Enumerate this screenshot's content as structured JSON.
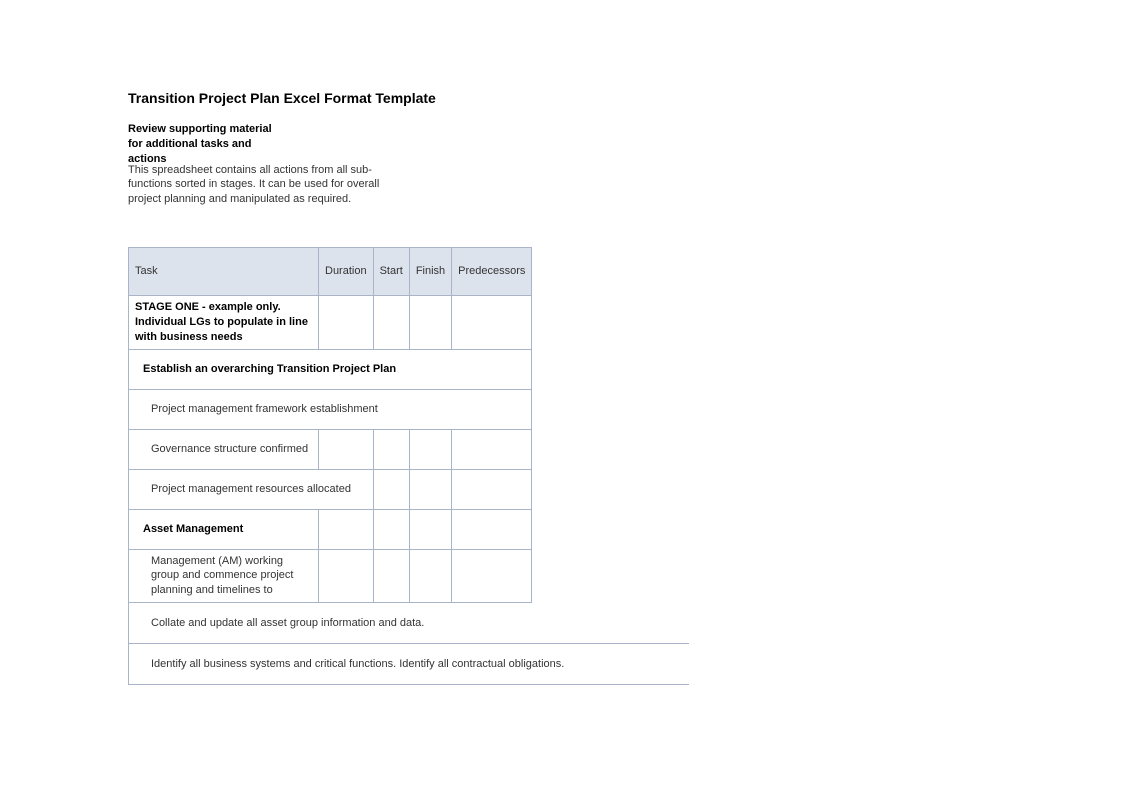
{
  "title": "Transition Project Plan Excel Format Template",
  "subtitle": "Review supporting material for additional tasks and actions",
  "description": "This spreadsheet contains all actions from all sub-functions sorted in stages. It can be used for overall project planning and manipulated as required.",
  "columns": {
    "task": "Task",
    "duration": "Duration",
    "start": "Start",
    "finish": "Finish",
    "predecessors": "Predecessors"
  },
  "rows": {
    "stage": "STAGE ONE - example only. Individual LGs to populate in line with business needs",
    "section1": "Establish an overarching Transition Project Plan",
    "sub1": "Project management framework establishment",
    "sub2": "Governance structure confirmed",
    "sub3": "Project management resources allocated",
    "section2": "Asset Management",
    "sub4": "Management (AM) working group and commence project planning and timelines to"
  },
  "overflow": {
    "item1": "Collate and update all asset group information and data.",
    "item2": "Identify all business systems and critical functions. Identify all contractual obligations."
  }
}
